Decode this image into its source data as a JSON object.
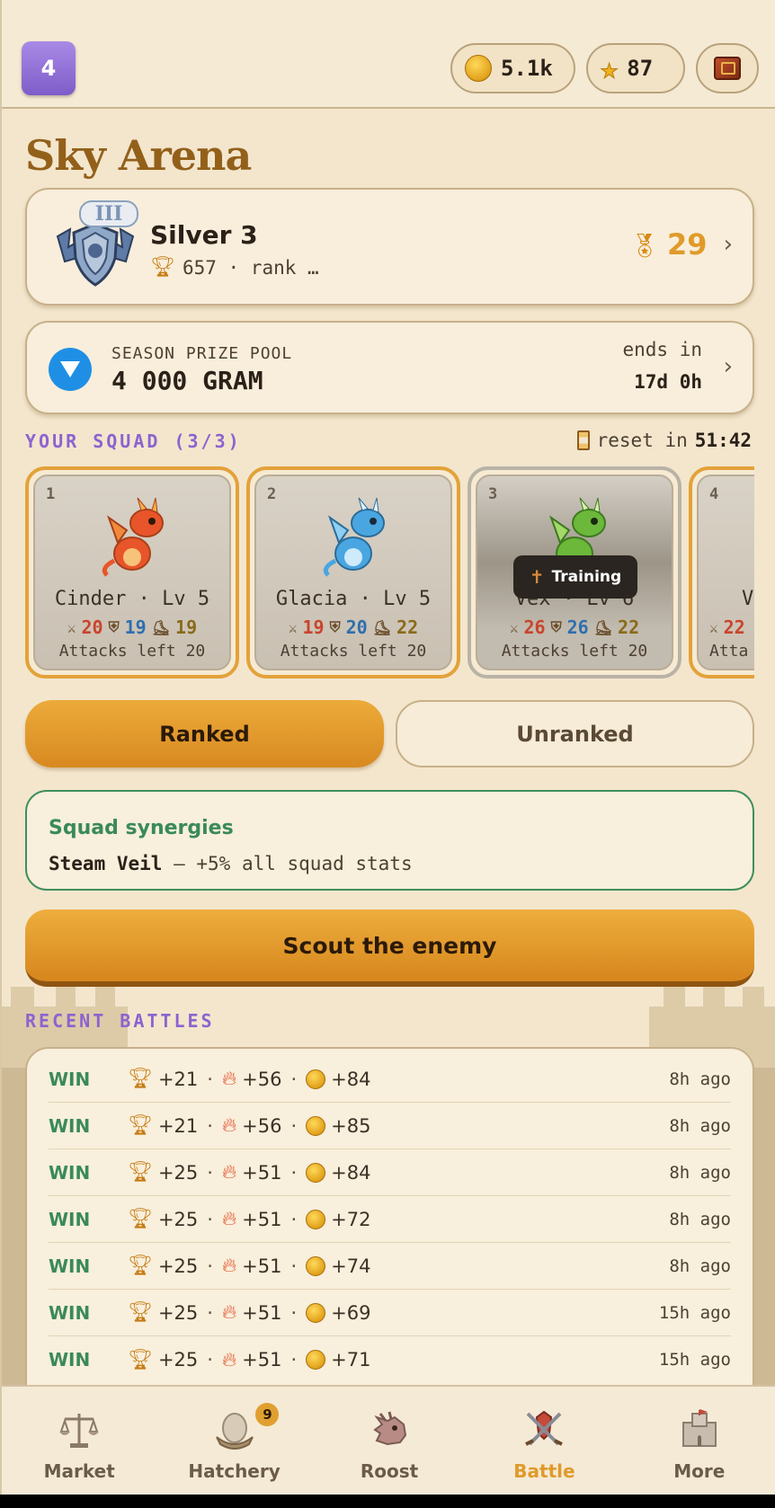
{
  "topbar": {
    "level": "4",
    "coins": "5.1k",
    "stars": "87",
    "icons": {
      "coin": "coin-icon",
      "star": "star-icon",
      "book": "quest-book-icon"
    }
  },
  "arena": {
    "title": "Sky Arena"
  },
  "league": {
    "tier_roman": "III",
    "name": "Silver 3",
    "trophies_rank": "657 · rank …",
    "points": "29",
    "chevron": "›"
  },
  "prize": {
    "label": "SEASON PRIZE POOL",
    "value": "4 000 GRAM",
    "ends_label": "ends in",
    "ends_value": "17d 0h",
    "chevron": "›"
  },
  "squad": {
    "heading": "YOUR SQUAD (3/3)",
    "reset_label": "reset in",
    "reset_time": "51:42",
    "training_label": "Training",
    "dragons": [
      {
        "slot": "1",
        "name": "Cinder · Lv 5",
        "atk": "20",
        "def": "19",
        "spd": "19",
        "attacks": "Attacks left 20",
        "color": "#e8552a",
        "state": "ready"
      },
      {
        "slot": "2",
        "name": "Glacia · Lv 5",
        "atk": "19",
        "def": "20",
        "spd": "22",
        "attacks": "Attacks left 20",
        "color": "#4aa6e0",
        "state": "ready"
      },
      {
        "slot": "3",
        "name": "Vex · Lv 6",
        "atk": "26",
        "def": "26",
        "spd": "22",
        "attacks": "Attacks left 20",
        "color": "#6cb83a",
        "state": "training"
      },
      {
        "slot": "4",
        "name": "Ve",
        "atk": "22",
        "def": "",
        "spd": "",
        "attacks": "Atta",
        "color": "#c9c0b2",
        "state": "ready"
      }
    ]
  },
  "mode": {
    "ranked": "Ranked",
    "unranked": "Unranked",
    "selected": "Ranked"
  },
  "synergy": {
    "title": "Squad synergies",
    "name": "Steam Veil",
    "desc": " — +5% all squad stats"
  },
  "scout": {
    "label": "Scout the enemy"
  },
  "battles": {
    "heading": "RECENT BATTLES",
    "rows": [
      {
        "result": "WIN",
        "trophies": "+21",
        "fire": "+56",
        "coins": "+84",
        "ago": "8h ago"
      },
      {
        "result": "WIN",
        "trophies": "+21",
        "fire": "+56",
        "coins": "+85",
        "ago": "8h ago"
      },
      {
        "result": "WIN",
        "trophies": "+25",
        "fire": "+51",
        "coins": "+84",
        "ago": "8h ago"
      },
      {
        "result": "WIN",
        "trophies": "+25",
        "fire": "+51",
        "coins": "+72",
        "ago": "8h ago"
      },
      {
        "result": "WIN",
        "trophies": "+25",
        "fire": "+51",
        "coins": "+74",
        "ago": "8h ago"
      },
      {
        "result": "WIN",
        "trophies": "+25",
        "fire": "+51",
        "coins": "+69",
        "ago": "15h ago"
      },
      {
        "result": "WIN",
        "trophies": "+25",
        "fire": "+51",
        "coins": "+71",
        "ago": "15h ago"
      }
    ]
  },
  "nav": {
    "items": [
      {
        "label": "Market",
        "icon": "scales-icon"
      },
      {
        "label": "Hatchery",
        "icon": "egg-nest-icon",
        "badge": "9"
      },
      {
        "label": "Roost",
        "icon": "dragon-head-icon"
      },
      {
        "label": "Battle",
        "icon": "crossed-swords-icon"
      },
      {
        "label": "More",
        "icon": "castle-icon"
      }
    ],
    "active": "Battle"
  },
  "colors": {
    "accent_orange": "#e09a2a",
    "title_brown": "#93601a",
    "section_purple": "#8c63cf",
    "win_green": "#3a8a58",
    "level_purple": "#8f6fd8"
  }
}
